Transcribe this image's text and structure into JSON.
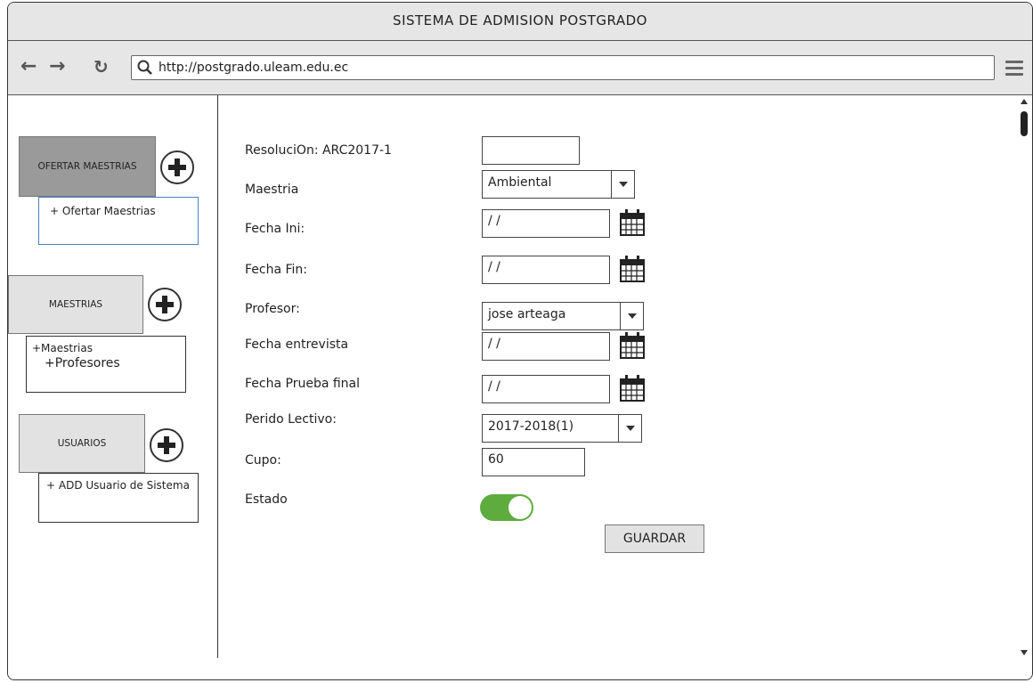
{
  "window": {
    "title": "SISTEMA DE ADMISION POSTGRADO"
  },
  "browser": {
    "url": "http://postgrado.uleam.edu.ec",
    "back_icon": "arrow-left-icon",
    "forward_icon": "arrow-right-icon",
    "reload_icon": "reload-icon",
    "search_icon": "search-icon",
    "menu_icon": "hamburger-menu-icon"
  },
  "sidebar": {
    "ofertar": {
      "label": "OFERTAR MAESTRIAS",
      "items": [
        "+ Ofertar Maestrias"
      ]
    },
    "maestrias": {
      "label": "MAESTRIAS",
      "items": [
        "+Maestrias",
        "+Profesores"
      ]
    },
    "usuarios": {
      "label": "USUARIOS",
      "items": [
        "+ ADD Usuario de Sistema"
      ]
    }
  },
  "form": {
    "resolucion": {
      "label": "ResoluciOn: ARC2017-1",
      "value": ""
    },
    "maestria": {
      "label": "Maestria",
      "value": "Ambiental"
    },
    "fecha_ini": {
      "label": "Fecha Ini:",
      "value": " /  /"
    },
    "fecha_fin": {
      "label": "Fecha Fin:",
      "value": " /  /"
    },
    "profesor": {
      "label": "Profesor:",
      "value": "jose arteaga"
    },
    "fecha_entrevista": {
      "label": "Fecha entrevista",
      "value": " /  /"
    },
    "fecha_prueba": {
      "label": "Fecha Prueba final",
      "value": " /  /"
    },
    "periodo": {
      "label": "Perido Lectivo:",
      "value": "2017-2018(1)"
    },
    "cupo": {
      "label": "Cupo:",
      "value": "60"
    },
    "estado": {
      "label": "Estado",
      "on": true,
      "color": "#5eab3e"
    },
    "guardar_label": "GUARDAR"
  }
}
